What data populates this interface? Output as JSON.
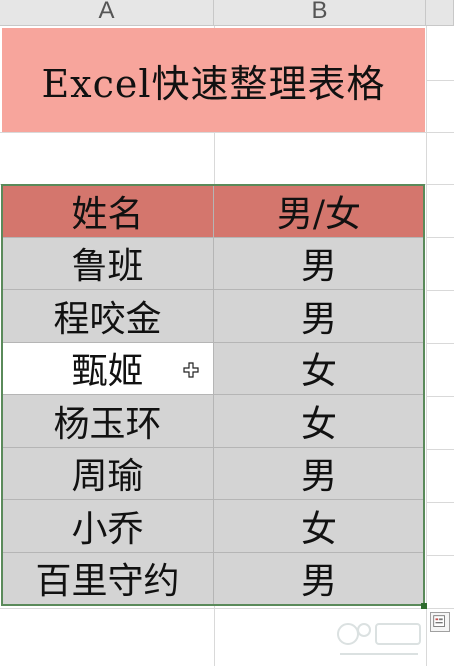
{
  "columns": [
    "A",
    "B"
  ],
  "title": "Excel快速整理表格",
  "table": {
    "headers": [
      "姓名",
      "男/女"
    ],
    "rows": [
      [
        "鲁班",
        "男"
      ],
      [
        "程咬金",
        "男"
      ],
      [
        "甄姬",
        "女"
      ],
      [
        "杨玉环",
        "女"
      ],
      [
        "周瑜",
        "男"
      ],
      [
        "小乔",
        "女"
      ],
      [
        "百里守约",
        "男"
      ]
    ]
  },
  "colors": {
    "title_bg": "#f7a59c",
    "header_bg": "#d4766d",
    "body_bg": "#d4d4d4",
    "selection_border": "#5a8a5a"
  },
  "icons": [
    "move-cursor-icon",
    "quick-analysis-icon",
    "watermark-logo-icon"
  ]
}
